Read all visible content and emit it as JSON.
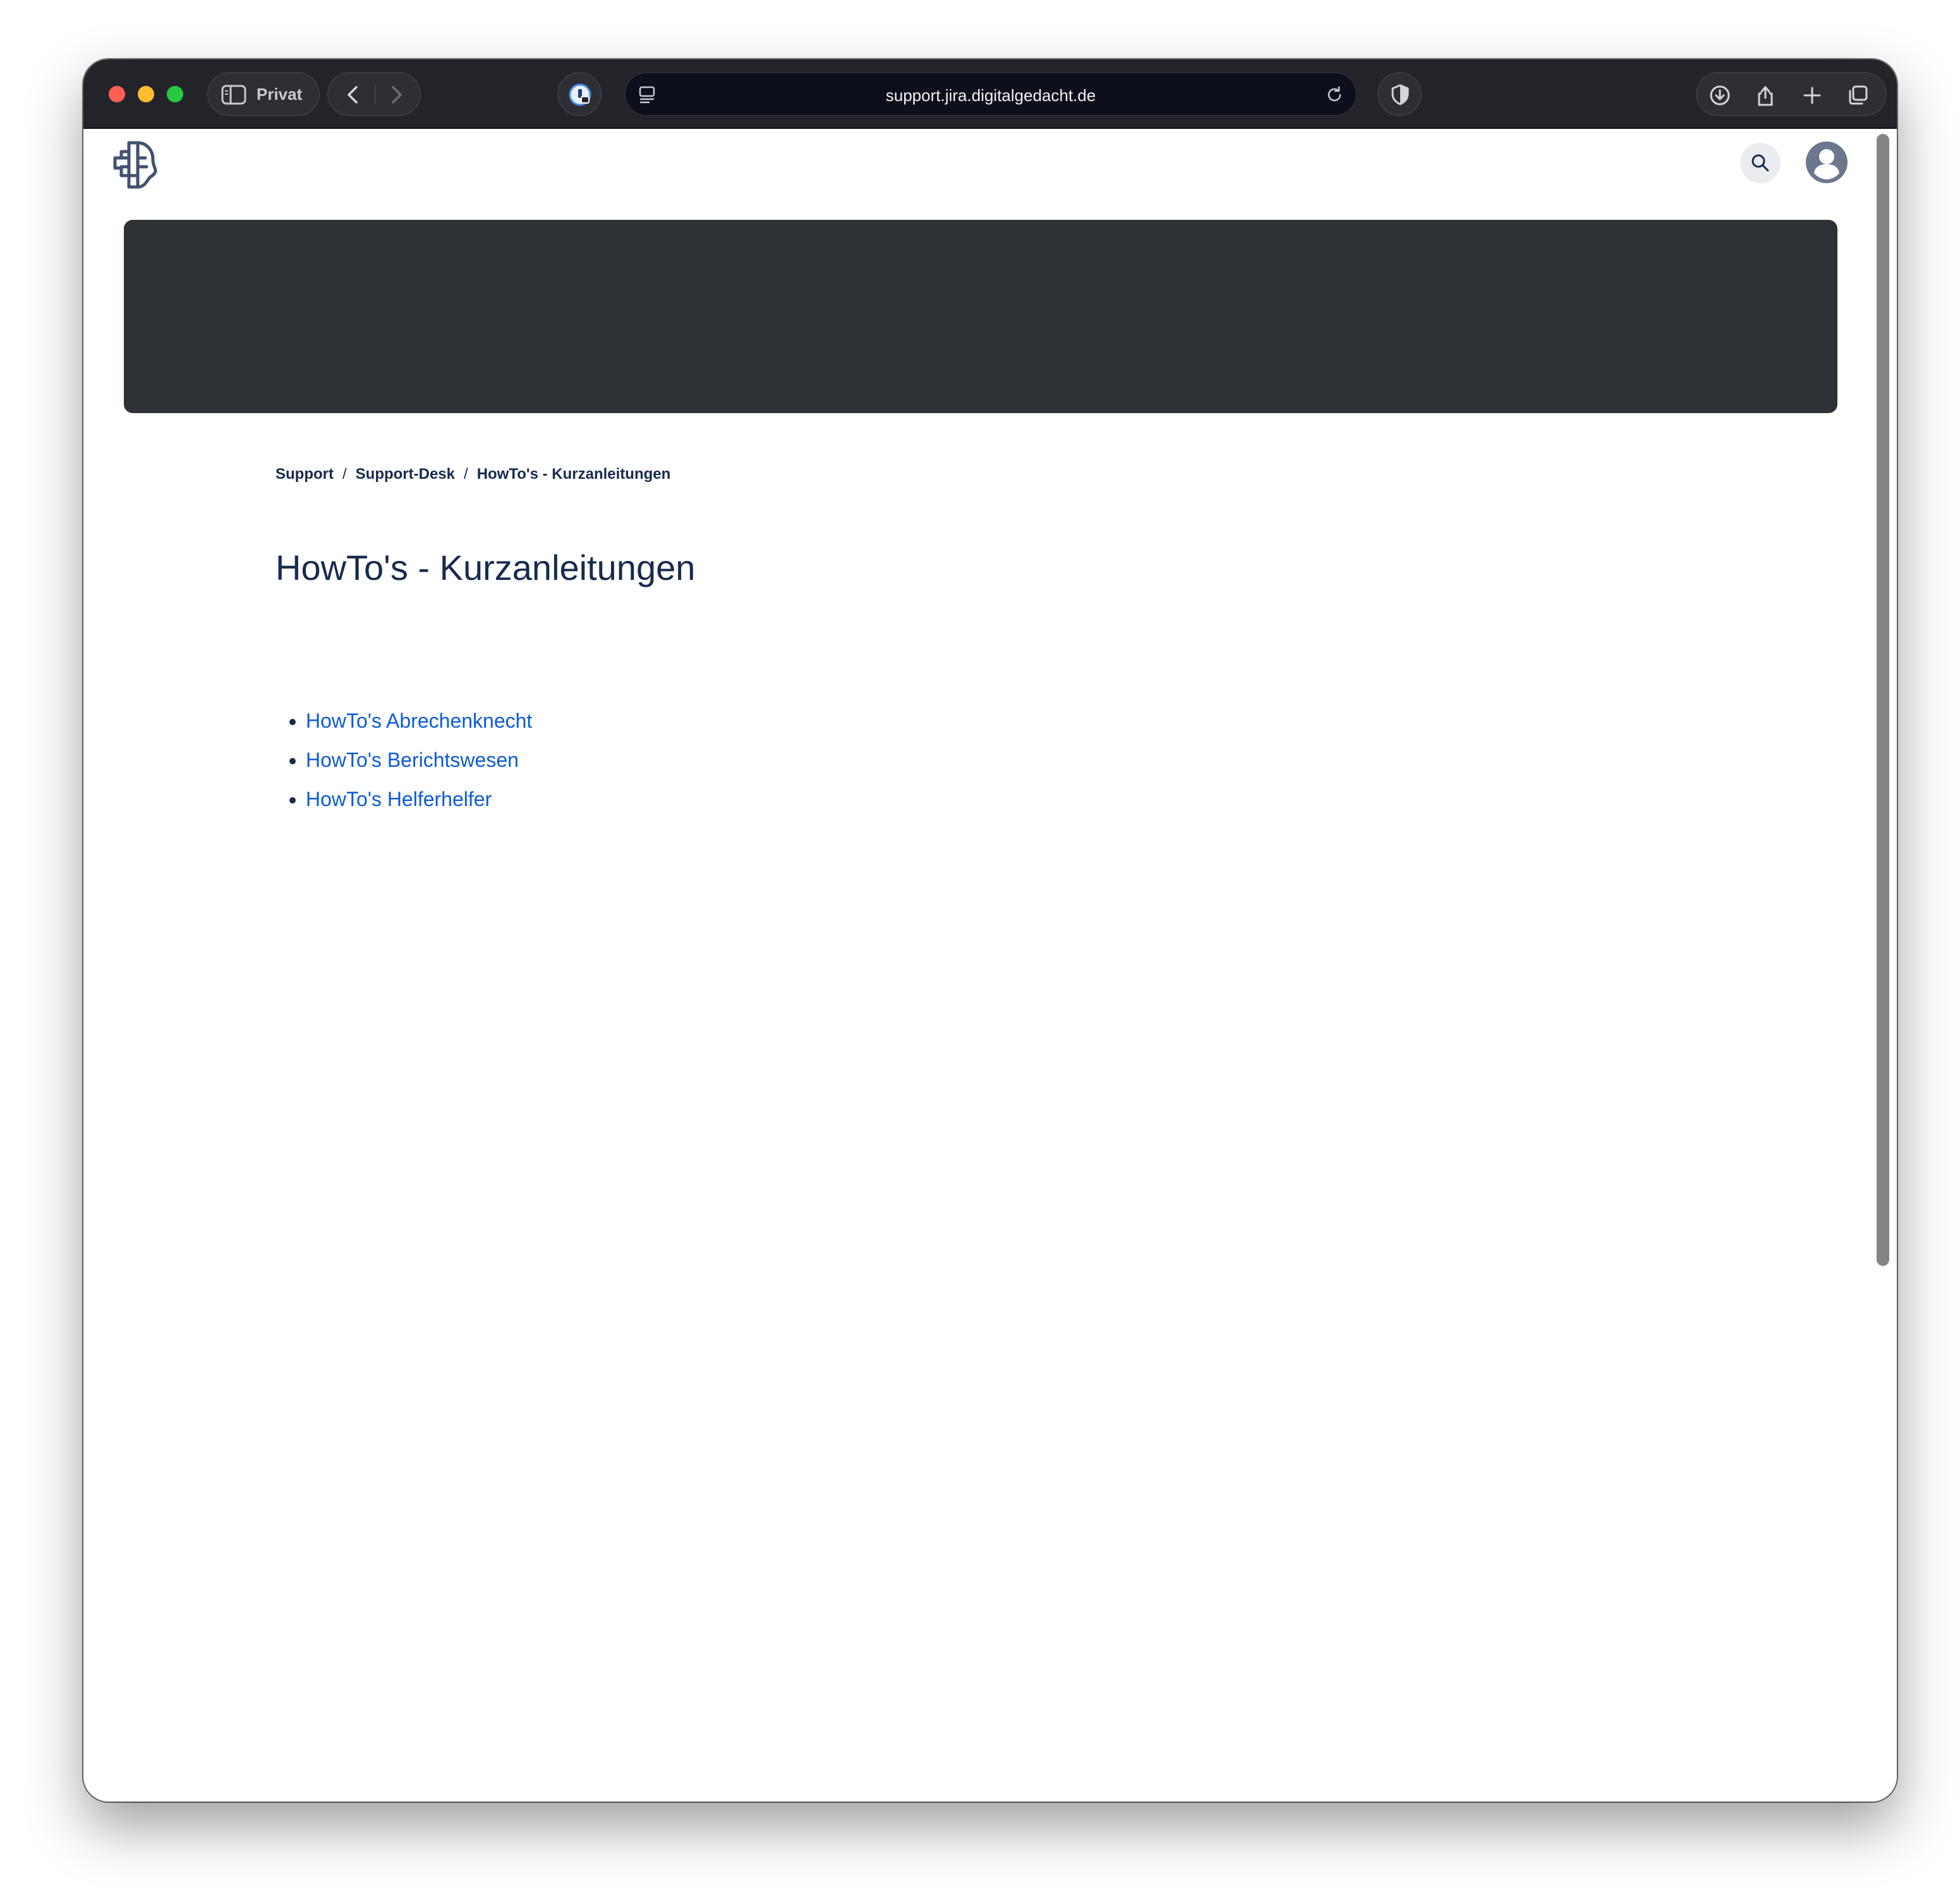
{
  "browser": {
    "private_label": "Privat",
    "url": "support.jira.digitalgedacht.de"
  },
  "breadcrumb": [
    {
      "label": "Support"
    },
    {
      "label": "Support-Desk"
    },
    {
      "label": "HowTo's - Kurzanleitungen"
    }
  ],
  "breadcrumb_separator": "/",
  "page": {
    "title": "HowTo's - Kurzanleitungen"
  },
  "links": [
    {
      "label": "HowTo's Abrechenknecht"
    },
    {
      "label": "HowTo's Berichtswesen"
    },
    {
      "label": "HowTo's Helferhelfer"
    }
  ],
  "colors": {
    "banner": "#2e3236",
    "link": "#0c5bd6",
    "text": "#172b4d",
    "titlebar": "#23242a"
  }
}
